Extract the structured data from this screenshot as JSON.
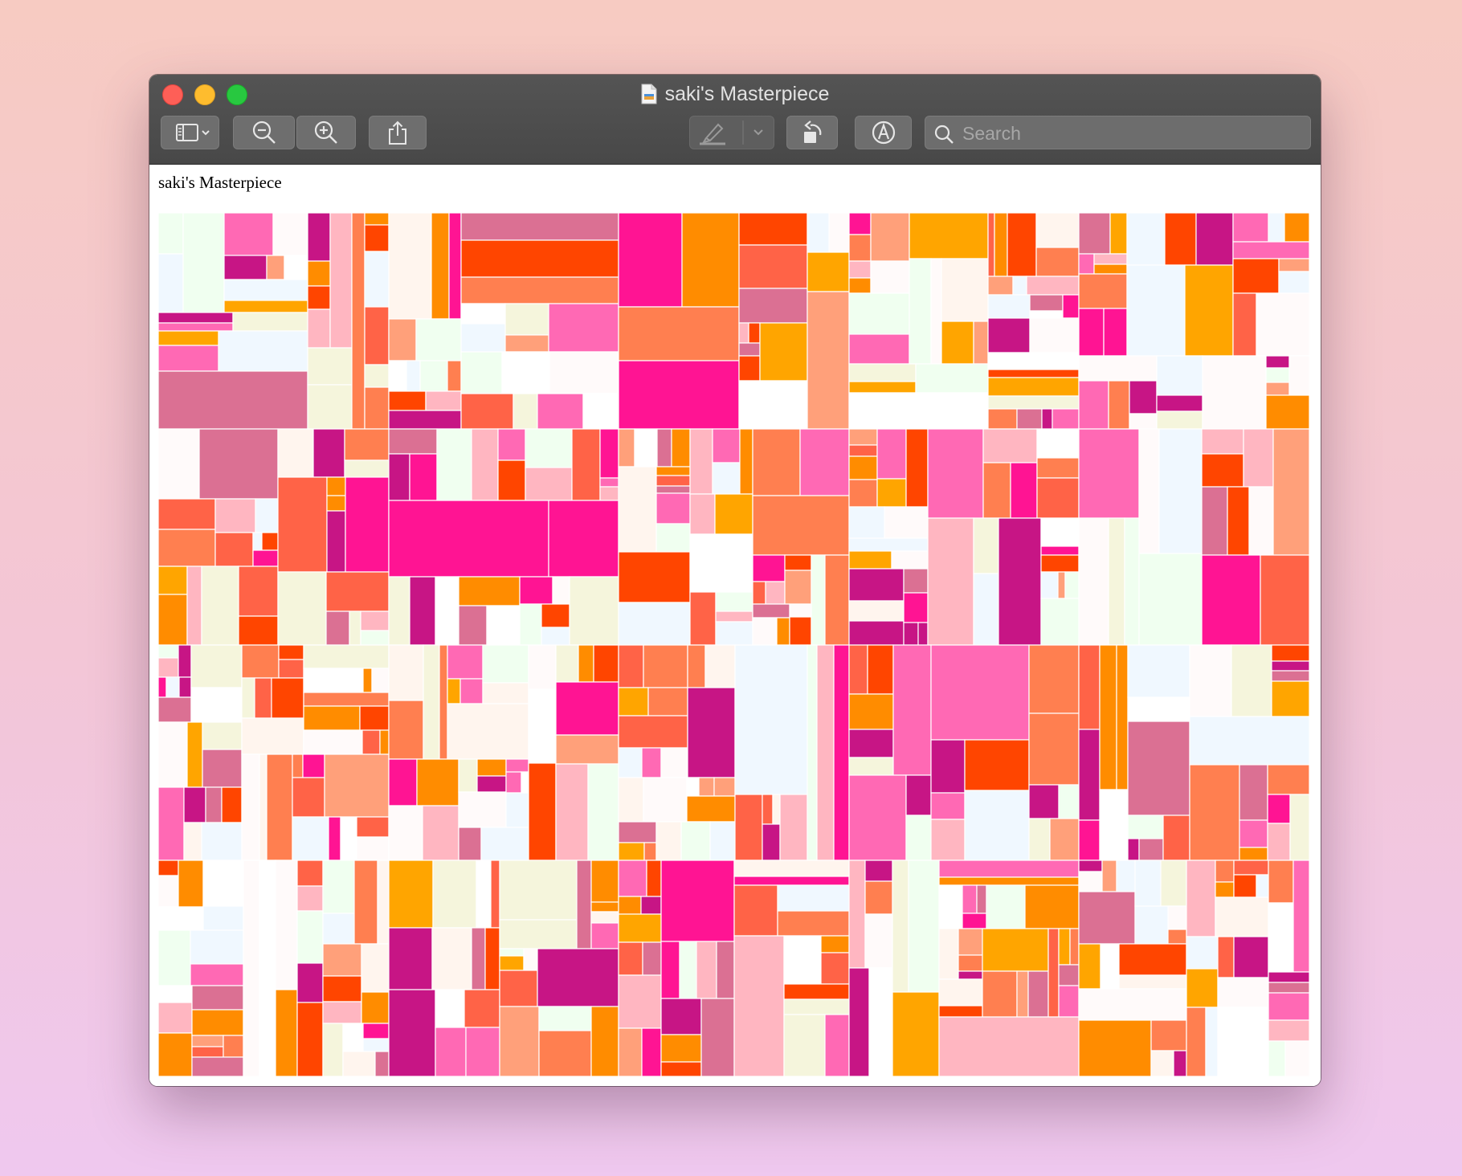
{
  "window": {
    "title": "saki's Masterpiece"
  },
  "toolbar": {
    "sidebar_button": {
      "icon": "sidebar-icon"
    },
    "zoom_out_button": {
      "icon": "zoom-out-icon"
    },
    "zoom_in_button": {
      "icon": "zoom-in-icon"
    },
    "share_button": {
      "icon": "share-icon"
    },
    "highlight_button": {
      "icon": "highlighter-icon"
    },
    "rotate_button": {
      "icon": "rotate-icon"
    },
    "markup_button": {
      "icon": "markup-icon"
    },
    "search": {
      "placeholder": "Search"
    }
  },
  "document": {
    "heading": "saki's Masterpiece",
    "palette": [
      "#ff6347",
      "#ff7f50",
      "#ffa07a",
      "#ffa500",
      "#ff8c00",
      "#ff4500",
      "#ff1493",
      "#ff69b4",
      "#ffb6c1",
      "#c71585",
      "#db7093",
      "#f0fff0",
      "#f0f8ff",
      "#fffafa",
      "#fff5ee",
      "#ffffff",
      "#f5f5dc"
    ]
  }
}
